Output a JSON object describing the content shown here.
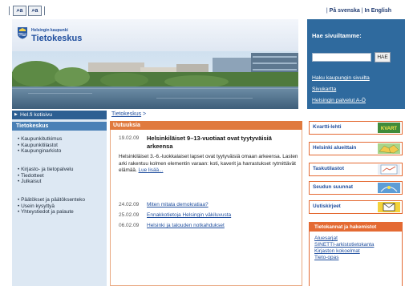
{
  "topbar": {
    "zoom_small": "a",
    "zoom_large": "a",
    "lang_swedish": "På svenska",
    "lang_english": "In English",
    "sep": "|"
  },
  "header": {
    "logo_small": "Helsingin kaupunki",
    "logo_big": "Tietokeskus",
    "search_title": "Hae sivuiltamme:",
    "search_placeholder": "",
    "search_button": "HAE",
    "search_links": [
      "Haku kaupungin sivuilta",
      "Sivukartta",
      "Helsingin palvelut A-Ö"
    ]
  },
  "nav": {
    "home": "Hel.fi kotisivu",
    "section": "Tietokeskus",
    "group1": [
      "Kaupunkitutkimus",
      "Kaupunkitilastot",
      "Kaupunginarkisto"
    ],
    "group2": [
      "Kirjasto- ja tietopalvelu",
      "Tiedotteet",
      "Julkaisut"
    ],
    "group3": [
      "Päätökset ja päätöksenteko",
      "Usein kysyttyä",
      "Yhteystiedot ja palaute"
    ]
  },
  "breadcrumb": {
    "item": "Tietokeskus",
    "sep": ">"
  },
  "news": {
    "header": "Uutuuksia",
    "lead": {
      "date": "19.02.09",
      "title": "Helsinkiläiset 9–13-vuotiaat ovat tyytyväisiä arkeensa",
      "body": "Helsinkiläiset 3.-6.-luokkalaiset lapset ovat tyytyväisiä omaan arkeensa. Lasten arki rakentuu kolmen elementin varaan: koti, kaverit ja harrastukset rytmittävät elämää.",
      "more": "Lue lisää..."
    },
    "items": [
      {
        "date": "24.02.09",
        "title": "Miten mitata demokratiaa?"
      },
      {
        "date": "25.02.09",
        "title": "Ennakkotietoja Helsingin väkiluvusta"
      },
      {
        "date": "06.02.09",
        "title": "Helsinki ja talouden notkahdukset"
      }
    ]
  },
  "promos": [
    {
      "label": "Kvartti-lehti",
      "badge": "KVART"
    },
    {
      "label": "Helsinki alueittain",
      "badge": ""
    },
    {
      "label": "Taskutilastot",
      "badge": ""
    },
    {
      "label": "Seudun suunnat",
      "badge": ""
    },
    {
      "label": "Uutiskirjeet",
      "badge": ""
    }
  ],
  "databases": {
    "header": "Tietokannat ja hakemistot",
    "links": [
      "Aluesarjat",
      "SINETTI-arkistotietokanta",
      "Kirjaston kokoelmat",
      "Tieto-opas"
    ]
  },
  "colors": {
    "nav_dark": "#2d5f92",
    "nav_mid": "#4a80b6",
    "nav_bg": "#dde8f3",
    "accent_orange": "#e46a33",
    "news_orange": "#e07a3e",
    "search_blue": "#2f6a9e"
  }
}
